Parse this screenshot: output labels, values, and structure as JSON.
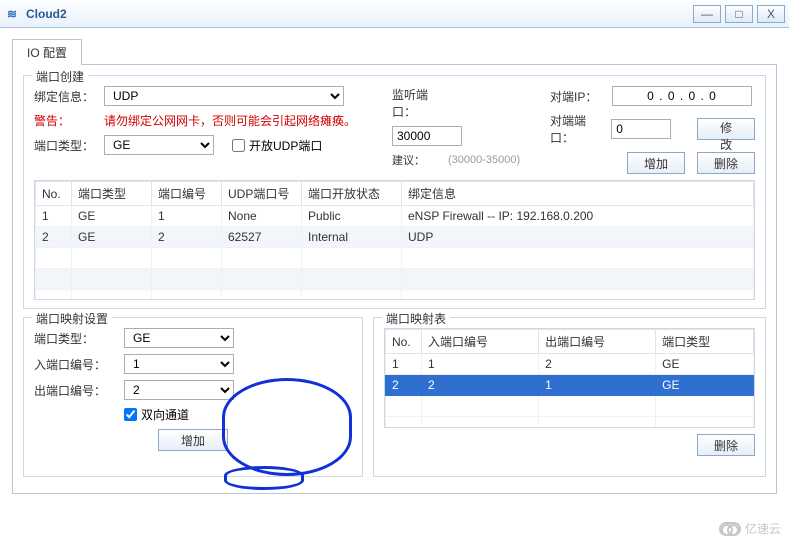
{
  "window": {
    "title": "Cloud2"
  },
  "tab": {
    "label": "IO 配置"
  },
  "portCreate": {
    "title": "端口创建",
    "bindInfoLabel": "绑定信息：",
    "bindInfoValue": "UDP",
    "warningLabel": "警告：",
    "warningText": "请勿绑定公网网卡，否则可能会引起网络瘫痪。",
    "portTypeLabel": "端口类型：",
    "portTypeValue": "GE",
    "openUdpLabel": "开放UDP端口",
    "listenPortLabel": "监听端口：",
    "listenPortValue": "30000",
    "suggestLabel": "建议：",
    "suggestRange": "(30000-35000)",
    "peerIpLabel": "对端IP：",
    "peerIpValue": "0  .  0  .  0  .  0",
    "peerPortLabel": "对端端口：",
    "peerPortValue": "0",
    "modifyBtn": "修改",
    "addBtn": "增加",
    "deleteBtn": "删除",
    "table": {
      "headers": [
        "No.",
        "端口类型",
        "端口编号",
        "UDP端口号",
        "端口开放状态",
        "绑定信息"
      ],
      "rows": [
        {
          "no": "1",
          "type": "GE",
          "num": "1",
          "udp": "None",
          "open": "Public",
          "bind": "eNSP Firewall -- IP: 192.168.0.200"
        },
        {
          "no": "2",
          "type": "GE",
          "num": "2",
          "udp": "62527",
          "open": "Internal",
          "bind": "UDP"
        }
      ]
    }
  },
  "mapSettings": {
    "title": "端口映射设置",
    "portTypeLabel": "端口类型：",
    "portTypeValue": "GE",
    "inPortLabel": "入端口编号：",
    "inPortValue": "1",
    "outPortLabel": "出端口编号：",
    "outPortValue": "2",
    "bidirLabel": "双向通道",
    "addBtn": "增加"
  },
  "mapTable": {
    "title": "端口映射表",
    "headers": [
      "No.",
      "入端口编号",
      "出端口编号",
      "端口类型"
    ],
    "rows": [
      {
        "no": "1",
        "in": "1",
        "out": "2",
        "type": "GE",
        "selected": false
      },
      {
        "no": "2",
        "in": "2",
        "out": "1",
        "type": "GE",
        "selected": true
      }
    ],
    "deleteBtn": "删除"
  },
  "watermark": "亿速云"
}
